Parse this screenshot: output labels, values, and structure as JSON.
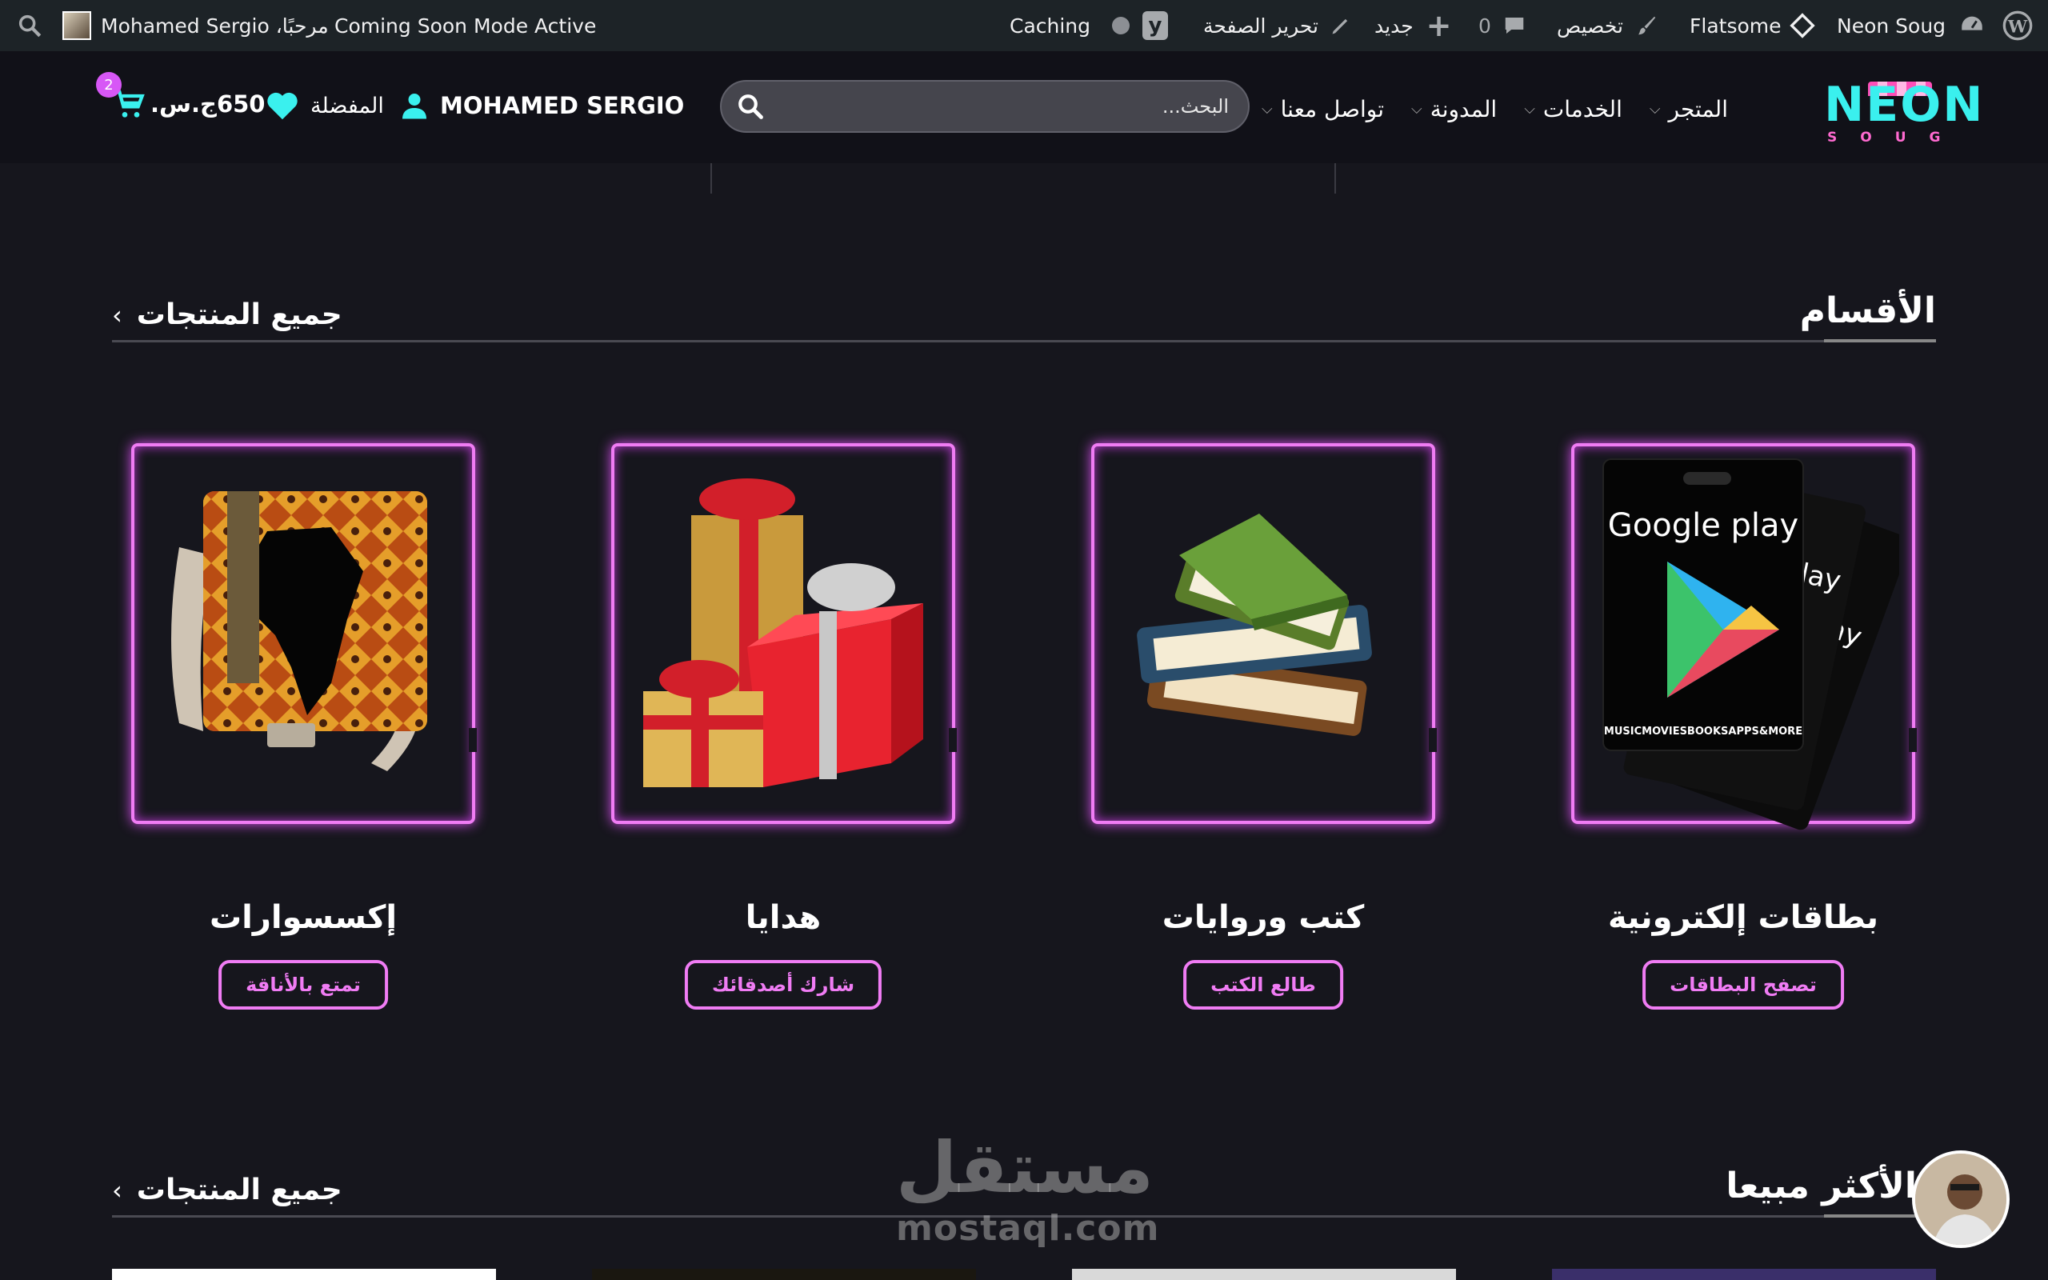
{
  "admin_bar": {
    "site_name": "Neon Soug",
    "theme": "Flatsome",
    "customize": "تخصيص",
    "comments_count": "0",
    "new": "جديد",
    "edit_page": "تحرير الصفحة",
    "caching": "Caching",
    "coming_soon": "Coming Soon Mode Active",
    "greeting": "مرحبًا، Mohamed Sergio"
  },
  "header": {
    "logo": {
      "main": "NEON",
      "sub": "SOUG"
    },
    "nav": [
      {
        "label": "المتجر"
      },
      {
        "label": "الخدمات"
      },
      {
        "label": "المدونة"
      },
      {
        "label": "تواصل معنا"
      }
    ],
    "search": {
      "placeholder": "البحث..."
    },
    "account_name": "MOHAMED SERGIO",
    "wishlist": "المفضلة",
    "cart": {
      "total": "650ج.س.",
      "count": "2"
    }
  },
  "categories_section": {
    "title": "الأقسام",
    "all_link": "جميع المنتجات",
    "items": [
      {
        "title": "بطاقات إلكترونية",
        "button": "تصفح البطاقات",
        "card_text_1": "Google play",
        "card_text_2": "MUSICMOVIESBOOKSAPPS&MORE"
      },
      {
        "title": "كتب وروايات",
        "button": "طالع الكتب"
      },
      {
        "title": "هدايا",
        "button": "شارك أصدقائك"
      },
      {
        "title": "إكسسوارات",
        "button": "تمتع بالأناقة"
      }
    ]
  },
  "bestsellers_section": {
    "title": "الأكثر مبيعا",
    "all_link": "جميع المنتجات"
  },
  "watermark": {
    "ar": "مستقل",
    "en": "mostaql.com"
  },
  "colors": {
    "neon_pink": "#f07cf4",
    "neon_cyan": "#3af0ee",
    "background": "#16161d",
    "admin_bar": "#1d2327"
  }
}
